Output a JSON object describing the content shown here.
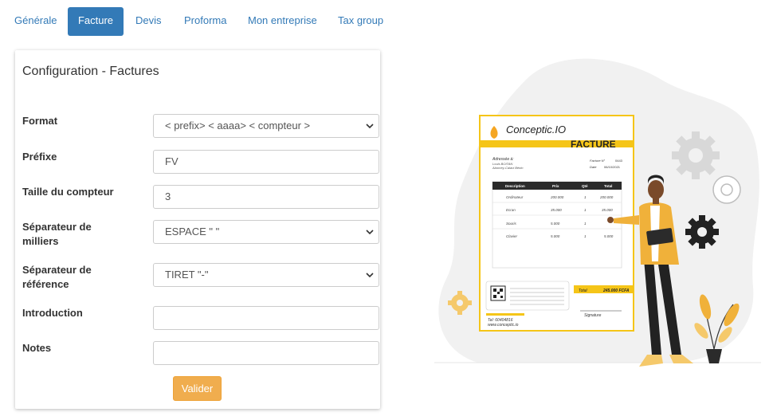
{
  "tabs": [
    {
      "label": "Générale"
    },
    {
      "label": "Facture"
    },
    {
      "label": "Devis"
    },
    {
      "label": "Proforma"
    },
    {
      "label": "Mon entreprise"
    },
    {
      "label": "Tax group"
    }
  ],
  "form": {
    "title": "Configuration - Factures",
    "format": {
      "label": "Format",
      "value": "< prefix> < aaaa> < compteur >"
    },
    "prefixe": {
      "label": "Préfixe",
      "value": "FV"
    },
    "taille": {
      "label": "Taille du compteur",
      "value": "3"
    },
    "sep_milliers": {
      "label_line1": "Séparateur de",
      "label_line2": "milliers",
      "value": "ESPACE \" \""
    },
    "sep_reference": {
      "label_line1": "Séparateur de",
      "label_line2": "référence",
      "value": "TIRET \"-\""
    },
    "introduction": {
      "label": "Introduction",
      "value": ""
    },
    "notes": {
      "label": "Notes",
      "value": ""
    },
    "submit_label": "Valider"
  },
  "invoice": {
    "brand": "Conceptic.IO",
    "heading": "FACTURE",
    "addressed_to": "Adressée à:",
    "client_name": "Louis BOITAN",
    "client_address": "Abomey-Calavi Bénin",
    "invoice_no_label": "Facture N°",
    "invoice_no": "0443",
    "date_label": "Date",
    "date": "06/10/2021",
    "columns": [
      "Description",
      "Prix",
      "Qté",
      "Total"
    ],
    "rows": [
      [
        "Ordinateur",
        "200.000",
        "1",
        "200.000"
      ],
      [
        "Ecran",
        "35.000",
        "1",
        "35.000"
      ],
      [
        "Souris",
        "5.000",
        "1",
        ""
      ],
      [
        "Clavier",
        "5.000",
        "1",
        "5.000"
      ]
    ],
    "total_label": "Total",
    "total_value": "245.000 FCFA",
    "signature_label": "Signature",
    "phone": "Tel: 60404816",
    "website": "www.conceptic.io"
  },
  "colors": {
    "tab_active": "#337ab7",
    "button": "#f0ad4e",
    "invoice_accent": "#f5c518",
    "blob": "#f1f1f1",
    "gear_dark": "#222222"
  }
}
